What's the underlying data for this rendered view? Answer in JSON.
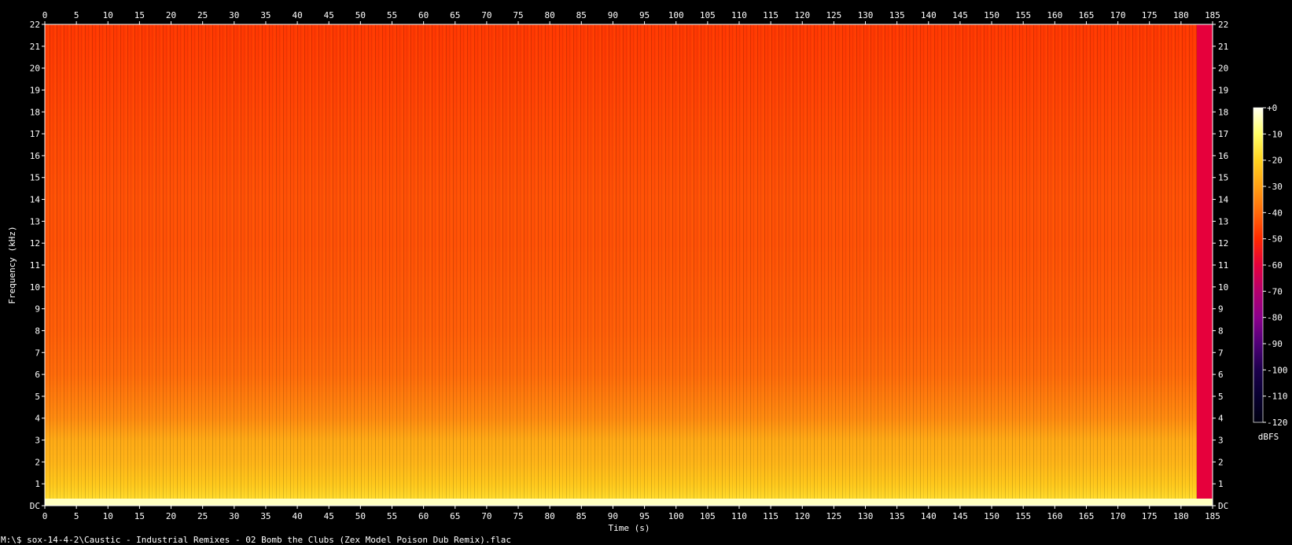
{
  "chart_data": {
    "type": "heatmap",
    "title": "",
    "xlabel": "Time (s)",
    "ylabel": "Frequency (kHz)",
    "xlim": [
      0,
      185
    ],
    "ylim": [
      0,
      22
    ],
    "x_ticks": [
      0,
      5,
      10,
      15,
      20,
      25,
      30,
      35,
      40,
      45,
      50,
      55,
      60,
      65,
      70,
      75,
      80,
      85,
      90,
      95,
      100,
      105,
      110,
      115,
      120,
      125,
      130,
      135,
      140,
      145,
      150,
      155,
      160,
      165,
      170,
      175,
      180,
      185
    ],
    "y_ticks": [
      "DC",
      "1",
      "2",
      "3",
      "4",
      "5",
      "6",
      "7",
      "8",
      "9",
      "10",
      "11",
      "12",
      "13",
      "14",
      "15",
      "16",
      "17",
      "18",
      "19",
      "20",
      "21",
      "22"
    ],
    "colorbar": {
      "label": "dBFS",
      "range": [
        -120,
        0
      ],
      "ticks": [
        "+0",
        "-10",
        "-20",
        "-30",
        "-40",
        "-50",
        "-60",
        "-70",
        "-80",
        "-90",
        "-100",
        "-110",
        "-120"
      ],
      "colors": [
        "#fffff0",
        "#ffff66",
        "#ffd21e",
        "#ffa014",
        "#ff6a0a",
        "#ff2a00",
        "#e6003c",
        "#b4006e",
        "#8c008c",
        "#500078",
        "#1c004c",
        "#080030",
        "#000010"
      ]
    },
    "level_profile_dbfs": {
      "frequency_khz": [
        0,
        0.3,
        1,
        2,
        3,
        4,
        5,
        6,
        8,
        10,
        12,
        14,
        16,
        18,
        20,
        22
      ],
      "level": [
        -10,
        -18,
        -22,
        -26,
        -28,
        -34,
        -37,
        -40,
        -42,
        -43,
        -44,
        -44,
        -45,
        -46,
        -47,
        -48
      ]
    },
    "tail_region": {
      "from_s": 182.5,
      "to_s": 185,
      "level_dbfs": -60
    },
    "grid": false,
    "colorbar_position": "right"
  },
  "footer": {
    "command": "M:\\$ sox-14-4-2\\Caustic - Industrial Remixes - 02 Bomb the Clubs (Zex Model Poison Dub Remix).flac"
  },
  "colors": {
    "background": "#000000",
    "text": "#ffffff"
  }
}
